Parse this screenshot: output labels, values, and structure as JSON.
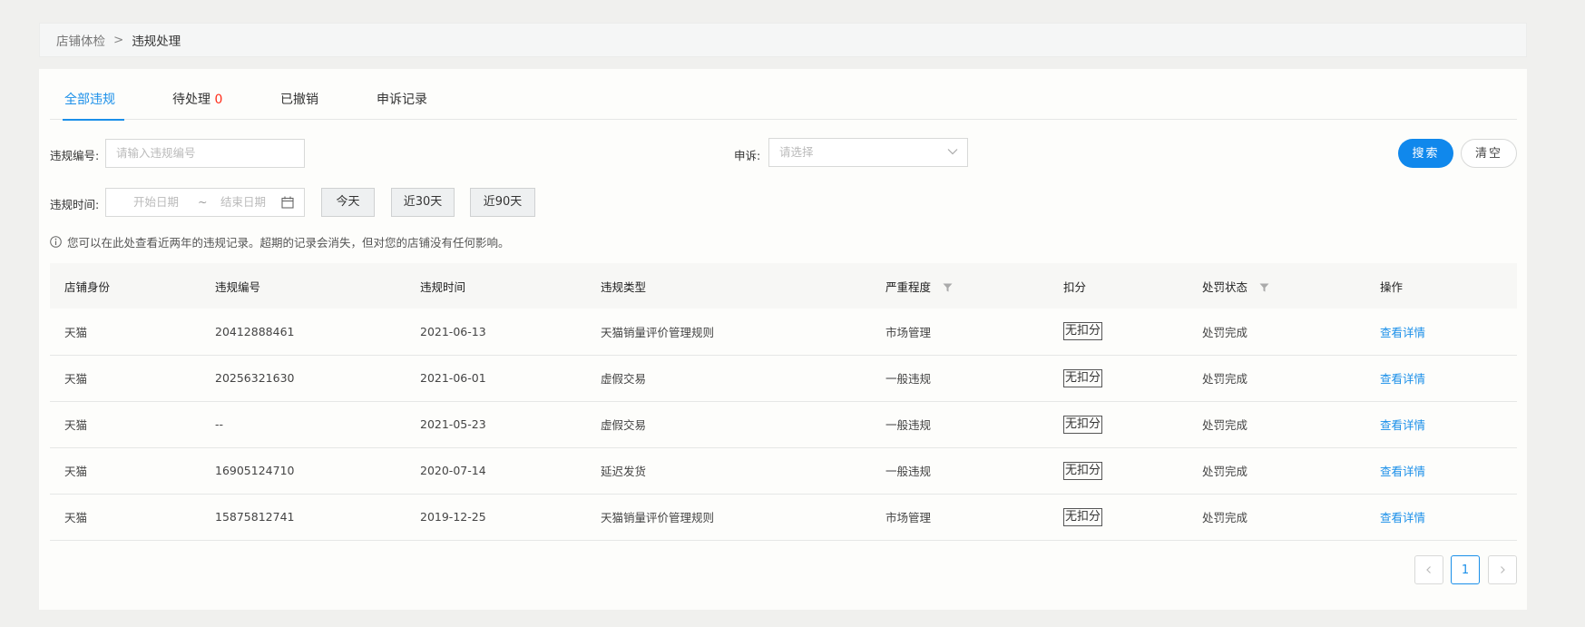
{
  "breadcrumb": {
    "home": "店铺体检",
    "separator": ">",
    "current": "违规处理"
  },
  "tabs": [
    {
      "label": "全部违规",
      "active": true
    },
    {
      "label": "待处理",
      "count": "0"
    },
    {
      "label": "已撤销"
    },
    {
      "label": "申诉记录"
    }
  ],
  "filters": {
    "violation_no_label": "违规编号:",
    "violation_no_placeholder": "请输入违规编号",
    "appeal_label": "申诉:",
    "appeal_placeholder": "请选择",
    "time_label": "违规时间:",
    "start_placeholder": "开始日期",
    "range_sep": "~",
    "end_placeholder": "结束日期",
    "quick": [
      "今天",
      "近30天",
      "近90天"
    ],
    "search": "搜索",
    "clear": "清空"
  },
  "notice": "您可以在此处查看近两年的违规记录。超期的记录会消失，但对您的店铺没有任何影响。",
  "table": {
    "headers": [
      "店铺身份",
      "违规编号",
      "违规时间",
      "违规类型",
      "严重程度",
      "扣分",
      "处罚状态",
      "操作"
    ],
    "rows": [
      [
        "天猫",
        "20412888461",
        "2021-06-13",
        "天猫销量评价管理规则",
        "市场管理",
        "无扣分",
        "处罚完成",
        "查看详情"
      ],
      [
        "天猫",
        "20256321630",
        "2021-06-01",
        "虚假交易",
        "一般违规",
        "无扣分",
        "处罚完成",
        "查看详情"
      ],
      [
        "天猫",
        "--",
        "2021-05-23",
        "虚假交易",
        "一般违规",
        "无扣分",
        "处罚完成",
        "查看详情"
      ],
      [
        "天猫",
        "16905124710",
        "2020-07-14",
        "延迟发货",
        "一般违规",
        "无扣分",
        "处罚完成",
        "查看详情"
      ],
      [
        "天猫",
        "15875812741",
        "2019-12-25",
        "天猫销量评价管理规则",
        "市场管理",
        "无扣分",
        "处罚完成",
        "查看详情"
      ]
    ]
  },
  "pagination": {
    "current": "1",
    "prev_icon": "chevron-left-icon",
    "next_icon": "chevron-right-icon"
  },
  "colors": {
    "accent": "#1a8fe9",
    "count": "#ff2d1a"
  }
}
